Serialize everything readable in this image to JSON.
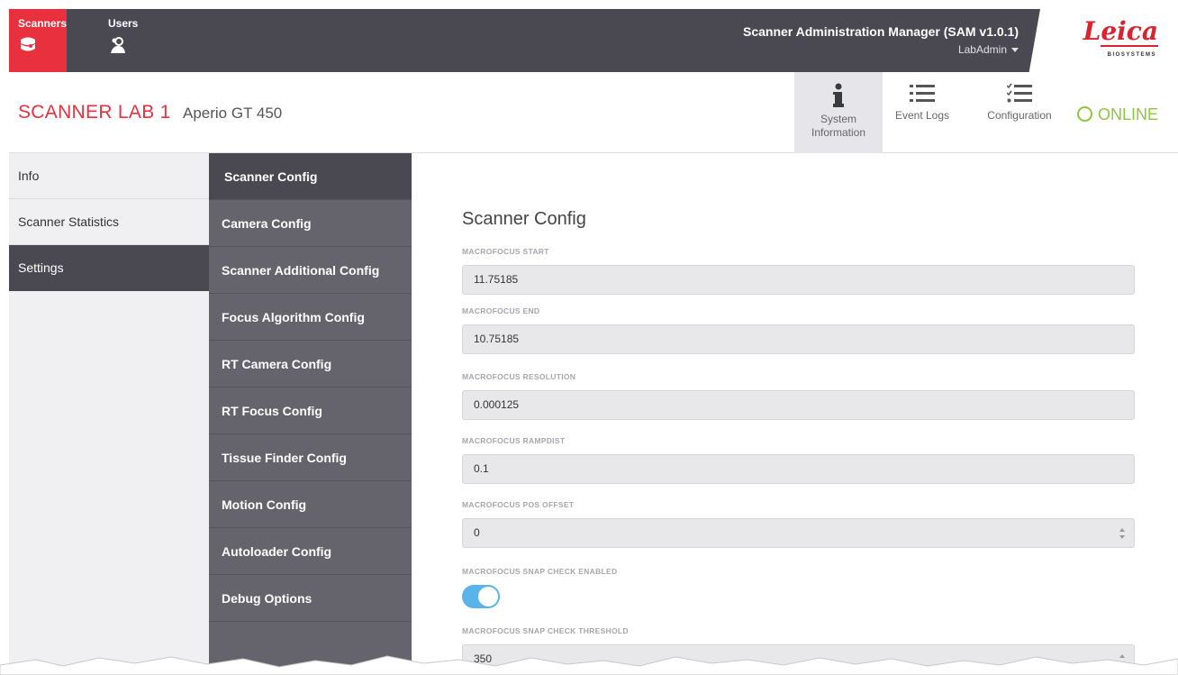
{
  "topbar": {
    "tabs": [
      {
        "label": "Scanners",
        "icon": "scanner-icon",
        "active": true
      },
      {
        "label": "Users",
        "icon": "users-icon",
        "active": false
      }
    ],
    "app_title": "Scanner Administration Manager (SAM v1.0.1)",
    "user": "LabAdmin",
    "logo": {
      "text": "Leica",
      "sub": "BIOSYSTEMS"
    }
  },
  "scanner": {
    "name": "SCANNER LAB 1",
    "model": "Aperio GT 450",
    "status": "ONLINE",
    "status_color": "#8dc63f",
    "buttons": [
      {
        "label": "System Information",
        "icon": "info-icon"
      },
      {
        "label": "Event Logs",
        "icon": "list-icon"
      },
      {
        "label": "Configuration",
        "icon": "checklist-icon"
      }
    ]
  },
  "leftnav": {
    "items": [
      {
        "label": "Info",
        "active": false
      },
      {
        "label": "Scanner Statistics",
        "active": false
      },
      {
        "label": "Settings",
        "active": true
      }
    ]
  },
  "subnav": {
    "items": [
      {
        "label": "Scanner Config",
        "active": true
      },
      {
        "label": "Camera Config",
        "active": false
      },
      {
        "label": "Scanner Additional Config",
        "active": false
      },
      {
        "label": "Focus Algorithm Config",
        "active": false
      },
      {
        "label": "RT Camera Config",
        "active": false
      },
      {
        "label": "RT Focus Config",
        "active": false
      },
      {
        "label": "Tissue Finder Config",
        "active": false
      },
      {
        "label": "Motion Config",
        "active": false
      },
      {
        "label": "Autoloader Config",
        "active": false
      },
      {
        "label": "Debug Options",
        "active": false
      }
    ]
  },
  "main": {
    "title": "Scanner Config",
    "fields": [
      {
        "label": "MACROFOCUS START",
        "value": "11.75185"
      },
      {
        "label": "MACROFOCUS END",
        "value": "10.75185"
      },
      {
        "label": "MACROFOCUS RESOLUTION",
        "value": "0.000125"
      },
      {
        "label": "MACROFOCUS RAMPDIST",
        "value": "0.1"
      },
      {
        "label": "MACROFOCUS POS OFFSET",
        "value": "0"
      },
      {
        "label": "MACROFOCUS SNAP CHECK ENABLED",
        "value": "on"
      },
      {
        "label": "MACROFOCUS SNAP CHECK THRESHOLD",
        "value": "350"
      }
    ]
  },
  "colors": {
    "accent_red": "#e8303f",
    "dark_bar": "#4a4952",
    "subnav_bg": "#65646d",
    "toggle_on": "#5bb4e8"
  }
}
